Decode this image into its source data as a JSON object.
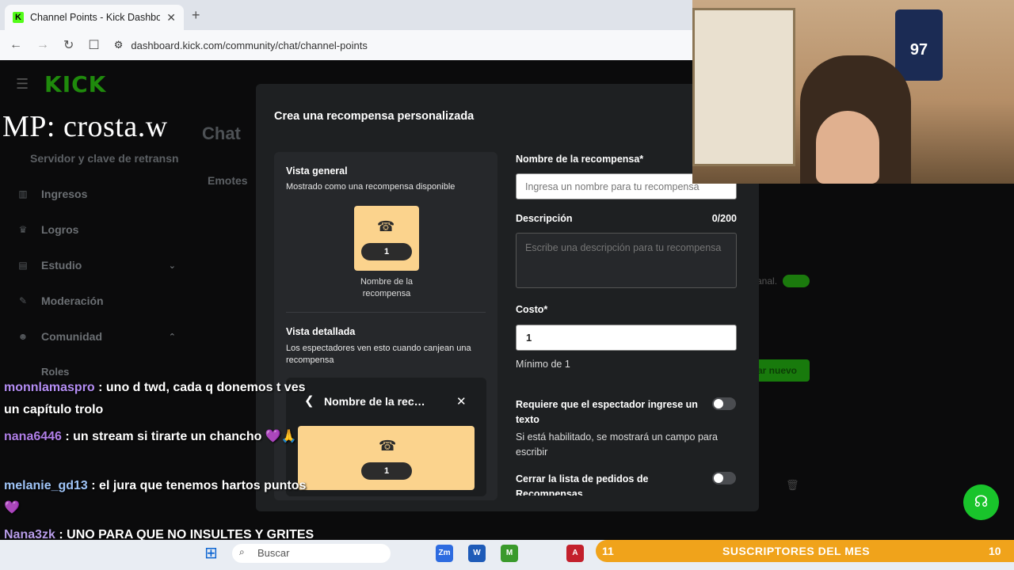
{
  "browser": {
    "tab_title": "Channel Points - Kick Dashboard",
    "tab_favicon": "K",
    "tab_close": "✕",
    "new_tab": "+",
    "url": "dashboard.kick.com/community/chat/channel-points"
  },
  "dashboard": {
    "logo": "KICK",
    "chat_title": "Chat",
    "emotes_tab": "Emotes",
    "server_key": "Servidor y clave de retransn",
    "sidebar": [
      {
        "label": "Ingresos",
        "icon": "chart-icon"
      },
      {
        "label": "Logros",
        "icon": "trophy-icon"
      },
      {
        "label": "Estudio",
        "icon": "studio-icon",
        "chevron": "⌄"
      },
      {
        "label": "Moderación",
        "icon": "wrench-icon"
      },
      {
        "label": "Comunidad",
        "icon": "people-icon",
        "chevron": "⌃"
      },
      {
        "label": "Roles",
        "icon": ""
      }
    ],
    "bg_toggle_text": "anal.",
    "bg_new_button": "ar nuevo"
  },
  "modal": {
    "title": "Crea una recompensa personalizada",
    "overview_title": "Vista general",
    "overview_desc": "Mostrado como una recompensa disponible",
    "reward_cost": "1",
    "reward_name": "Nombre de la recompensa",
    "detail_title": "Vista detallada",
    "detail_desc": "Los espectadores ven esto cuando canjean una recompensa",
    "detail_name": "Nombre de la reco...",
    "detail_cost": "1",
    "name_label": "Nombre de la recompensa*",
    "name_placeholder": "Ingresa un nombre para tu recompensa",
    "desc_label": "Descripción",
    "desc_count": "0/200",
    "desc_placeholder": "Escribe una descripción para tu recompensa",
    "cost_label": "Costo*",
    "cost_value": "1",
    "cost_hint": "Mínimo de 1",
    "require_text_label": "Requiere que el espectador ingrese un texto",
    "require_text_help": "Si está habilitado, se mostrará un campo para escribir",
    "close_queue_label": "Cerrar la lista de pedidos de Recompensas"
  },
  "overlay": {
    "mp_text": "MP: crosta.w",
    "chat": [
      {
        "user": "monnlamaspro",
        "text": " : uno d twd, cada q donemos t ves un capítulo trolo"
      },
      {
        "user": "nana6446",
        "text": " : un stream si tirarte un chancho 💜🙏"
      },
      {
        "user": "melanie_gd13",
        "text": " : el jura que tenemos hartos puntos 💜"
      },
      {
        "user": "Nana3zk",
        "text": " : UNO PARA QUE NO INSULTES Y GRITES DE LA NADA"
      }
    ],
    "sub_left": "11",
    "sub_title": "SUSCRIPTORES DEL MES",
    "sub_right": "10",
    "jersey_number": "97"
  },
  "taskbar": {
    "search_placeholder": "Buscar",
    "apps": [
      "Zm",
      "W",
      "M",
      "A"
    ]
  },
  "colors": {
    "kick_green": "#53fc18",
    "reward_card": "#fbd38d",
    "modal_bg": "#1e2022",
    "sub_banner": "#f0a31b"
  }
}
